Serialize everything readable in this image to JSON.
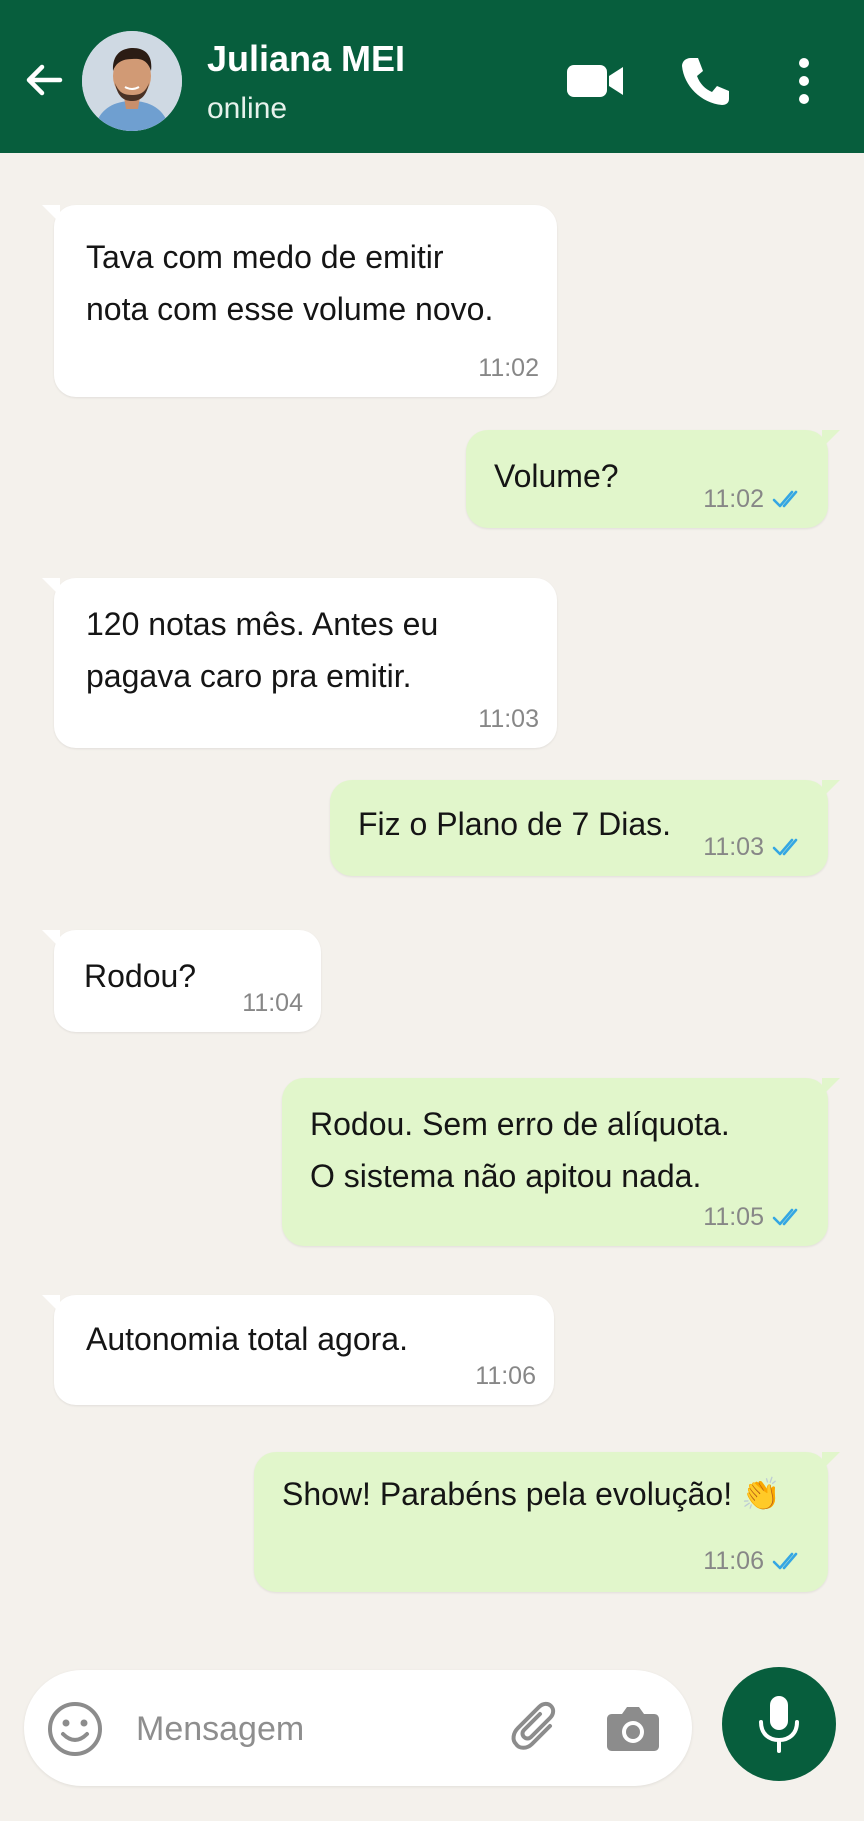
{
  "header": {
    "contact_name": "Juliana MEI",
    "contact_status": "online",
    "icons": [
      "back-arrow-icon",
      "avatar",
      "video-call-icon",
      "phone-call-icon",
      "more-options-icon"
    ]
  },
  "messages": [
    {
      "direction": "incoming",
      "text": "Tava com medo de emitir\nnota com esse volume novo.",
      "time": "11:02"
    },
    {
      "direction": "outgoing",
      "text": "Volume?",
      "time": "11:02",
      "status": "read"
    },
    {
      "direction": "incoming",
      "text": "120 notas mês. Antes eu\npagava caro pra emitir.",
      "time": "11:03"
    },
    {
      "direction": "outgoing",
      "text": "Fiz o Plano de 7 Dias.",
      "time": "11:03",
      "status": "read"
    },
    {
      "direction": "incoming",
      "text": "Rodou?",
      "time": "11:04"
    },
    {
      "direction": "outgoing",
      "text": "Rodou. Sem erro de alíquota.\nO sistema não apitou nada.",
      "time": "11:05",
      "status": "read"
    },
    {
      "direction": "incoming",
      "text": "Autonomia total agora.",
      "time": "11:06"
    },
    {
      "direction": "outgoing",
      "text": "Show! Parabéns pela evolução! 👏",
      "time": "11:06",
      "status": "read"
    }
  ],
  "composer": {
    "placeholder": "Mensagem",
    "icons": [
      "emoji-icon",
      "attach-icon",
      "camera-icon",
      "mic-icon"
    ]
  },
  "colors": {
    "header": "#075e3d",
    "background": "#f4f1ec",
    "outgoing_bubble": "#e1f6cb",
    "incoming_bubble": "#ffffff",
    "read_ticks": "#34a6e3"
  }
}
